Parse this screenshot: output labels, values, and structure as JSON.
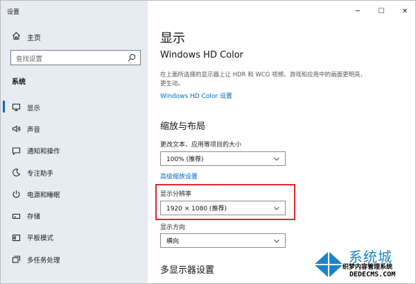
{
  "window": {
    "title": "设置",
    "minimize_glyph": "─",
    "maximize_glyph": "☐",
    "close_glyph": "✕"
  },
  "sidebar": {
    "home_label": "主页",
    "search_placeholder": "查找设置",
    "section_title": "系统",
    "items": [
      {
        "label": "显示",
        "icon": "monitor-icon",
        "active": true
      },
      {
        "label": "声音",
        "icon": "speaker-icon"
      },
      {
        "label": "通知和操作",
        "icon": "notification-icon"
      },
      {
        "label": "专注助手",
        "icon": "moon-icon"
      },
      {
        "label": "电源和睡眠",
        "icon": "power-icon"
      },
      {
        "label": "存储",
        "icon": "storage-icon"
      },
      {
        "label": "平板模式",
        "icon": "tablet-icon"
      },
      {
        "label": "多任务处理",
        "icon": "multitask-icon"
      }
    ]
  },
  "main": {
    "page_title": "显示",
    "hd_title": "Windows HD Color",
    "hd_description": "在上面所选择的显示器上让 HDR 和 WCG 视频、游戏和应用中的画面更明亮、更生动。",
    "hd_link": "Windows HD Color 设置",
    "scale_title": "缩放与布局",
    "scale_label": "更改文本、应用等项目的大小",
    "scale_value": "100% (推荐)",
    "advanced_link": "高级缩放设置",
    "resolution_label": "显示分辨率",
    "resolution_value": "1920 × 1080 (推荐)",
    "orientation_label": "显示方向",
    "orientation_value": "横向",
    "multi_title": "多显示器设置"
  },
  "watermark": {
    "name": "系统城",
    "sub1": "织梦内容管理系统",
    "sub2": "DEDECMS.COM"
  },
  "colors": {
    "accent": "#0067c0",
    "highlight": "#e3242b",
    "sidebar_bg": "#e6ecf1"
  }
}
